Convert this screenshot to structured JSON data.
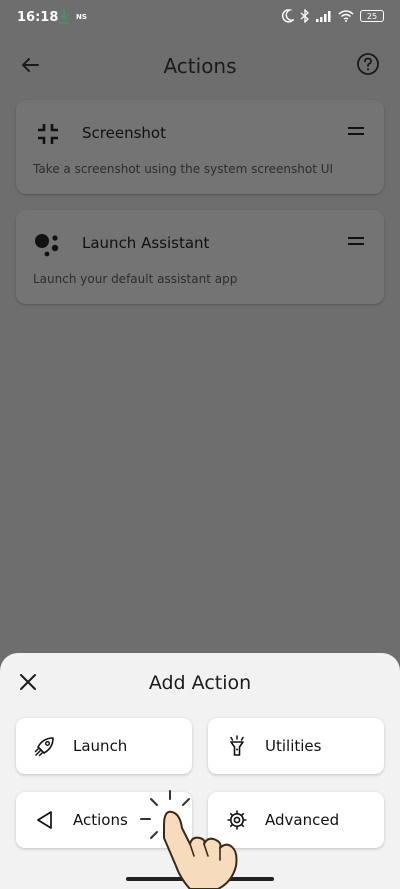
{
  "status_bar": {
    "time": "16:18",
    "notif_label": "NS",
    "battery": "25"
  },
  "appbar": {
    "title": "Actions"
  },
  "cards": [
    {
      "title": "Screenshot",
      "description": "Take a screenshot using the system screenshot UI"
    },
    {
      "title": "Launch Assistant",
      "description": "Launch your default assistant app"
    }
  ],
  "sheet": {
    "title": "Add Action",
    "buttons": [
      {
        "label": "Launch",
        "icon": "rocket-icon"
      },
      {
        "label": "Utilities",
        "icon": "flashlight-icon"
      },
      {
        "label": "Actions",
        "icon": "triangle-back-icon"
      },
      {
        "label": "Advanced",
        "icon": "gear-icon"
      }
    ]
  }
}
